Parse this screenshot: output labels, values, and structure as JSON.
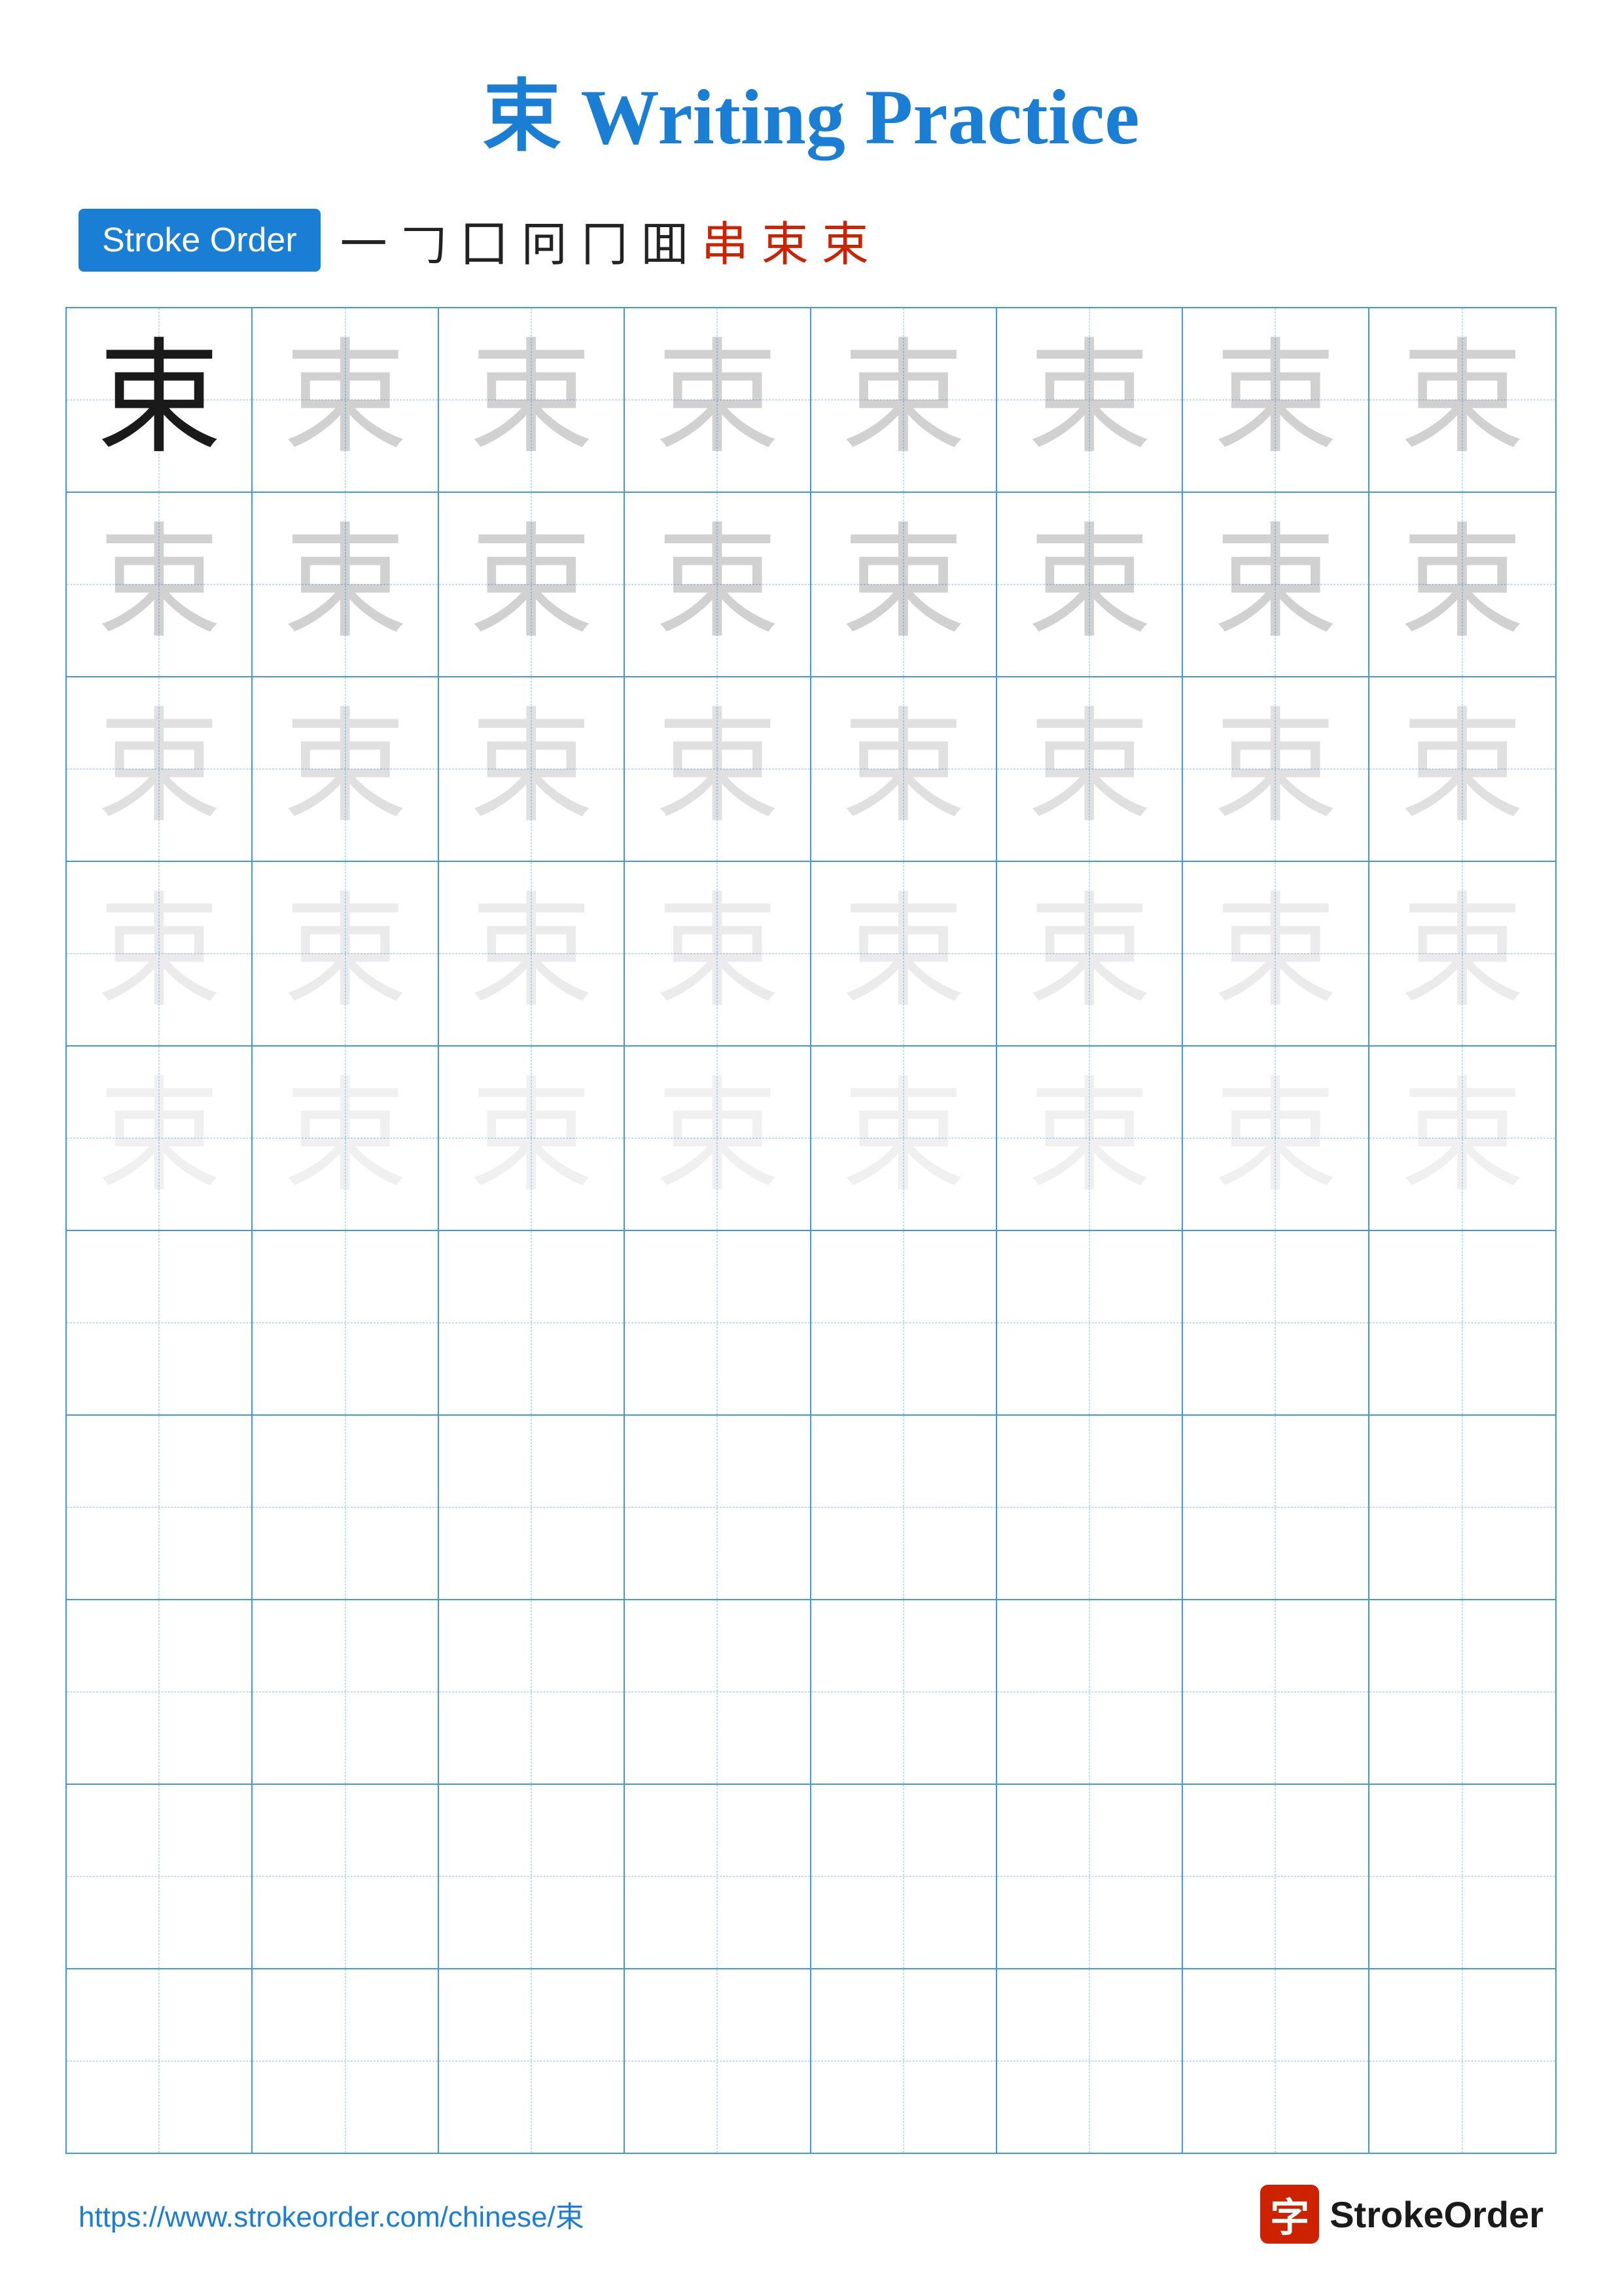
{
  "title": {
    "char": "束",
    "text": "Writing Practice",
    "full": "束 Writing Practice"
  },
  "stroke_order": {
    "badge_label": "Stroke Order",
    "chars": [
      "一",
      "𠃌",
      "囗",
      "冋",
      "冂",
      "囬",
      "串",
      "束",
      "束"
    ]
  },
  "grid": {
    "rows": 10,
    "cols": 8
  },
  "character": "束",
  "footer": {
    "url": "https://www.strokeorder.com/chinese/束",
    "logo_char": "字",
    "logo_text": "StrokeOrder"
  }
}
